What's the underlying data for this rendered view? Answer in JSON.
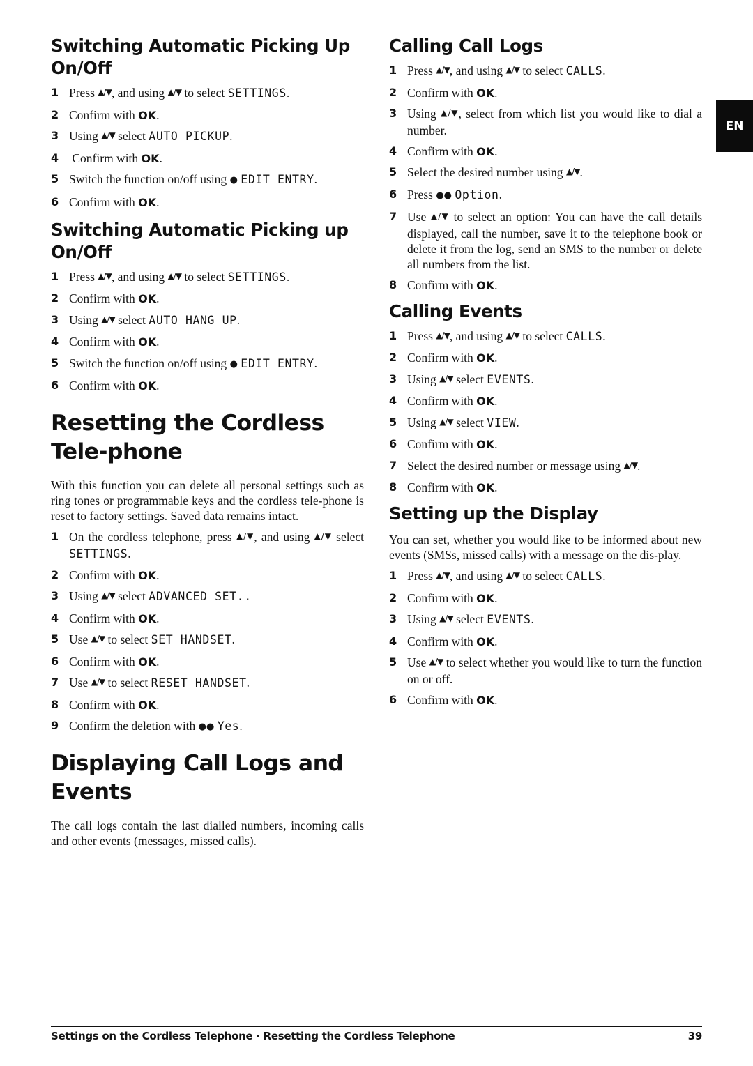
{
  "icons": {
    "up_down": "▲/▼",
    "single_dot": "●",
    "double_dot": "●●"
  },
  "language_tab": "EN",
  "left": {
    "section1": {
      "title": "Switching Automatic Picking Up On/Off",
      "steps": [
        {
          "n": "1",
          "pre": "Press ",
          "mid": ", and using ",
          "post": " to select ",
          "lcd": "SETTINGS",
          "end": "."
        },
        {
          "n": "2",
          "text": "Confirm with ",
          "ok": "OK",
          "end": "."
        },
        {
          "n": "3",
          "pre": "Using ",
          "post": " select ",
          "lcd": "AUTO PICKUP",
          "end": "."
        },
        {
          "n": "4",
          "text": " Confirm with ",
          "ok": "OK",
          "end": "."
        },
        {
          "n": "5",
          "text": "Switch the function on/off using ",
          "lcd": "EDIT ENTRY",
          "end": "."
        },
        {
          "n": "6",
          "text": "Confirm with ",
          "ok": "OK",
          "end": "."
        }
      ]
    },
    "section2": {
      "title": "Switching Automatic Picking up On/Off",
      "steps": [
        {
          "n": "1",
          "pre": "Press ",
          "mid": ", and using ",
          "post": " to select ",
          "lcd": "SETTINGS",
          "end": "."
        },
        {
          "n": "2",
          "text": "Confirm with ",
          "ok": "OK",
          "end": "."
        },
        {
          "n": "3",
          "pre": "Using ",
          "post": " select ",
          "lcd": "AUTO HANG UP",
          "end": "."
        },
        {
          "n": "4",
          "text": "Confirm with ",
          "ok": "OK",
          "end": "."
        },
        {
          "n": "5",
          "text": "Switch the function on/off using ",
          "lcd": "EDIT ENTRY",
          "end": "."
        },
        {
          "n": "6",
          "text": "Confirm with ",
          "ok": "OK",
          "end": "."
        }
      ]
    },
    "section3": {
      "title": "Resetting the Cordless Tele-phone",
      "intro": "With this function you can delete all personal settings such as ring tones or programmable keys and the cordless tele-phone is reset to factory settings. Saved data remains intact.",
      "steps": [
        {
          "n": "1",
          "pre": "On the cordless telephone, press ",
          "mid": ", and using ",
          "post": " select ",
          "lcd": "SETTINGS",
          "end": "."
        },
        {
          "n": "2",
          "text": "Confirm with ",
          "ok": "OK",
          "end": "."
        },
        {
          "n": "3",
          "pre": "Using ",
          "post": " select ",
          "lcd": "ADVANCED SET..",
          "end": ""
        },
        {
          "n": "4",
          "text": "Confirm with ",
          "ok": "OK",
          "end": "."
        },
        {
          "n": "5",
          "pre": "Use ",
          "post": " to select ",
          "lcd": "SET HANDSET",
          "end": "."
        },
        {
          "n": "6",
          "text": "Confirm with ",
          "ok": "OK",
          "end": "."
        },
        {
          "n": "7",
          "pre": "Use ",
          "post": " to select ",
          "lcd": "RESET HANDSET",
          "end": "."
        },
        {
          "n": "8",
          "text": "Confirm with ",
          "ok": "OK",
          "end": "."
        },
        {
          "n": "9",
          "text": "Confirm the deletion with ",
          "lcd": "Yes",
          "end": "."
        }
      ]
    },
    "section4": {
      "title": "Displaying Call Logs and Events",
      "intro": "The call logs contain the last dialled numbers, incoming calls and other events (messages, missed calls)."
    }
  },
  "right": {
    "section1": {
      "title": "Calling Call Logs",
      "steps": [
        {
          "n": "1",
          "pre": "Press ",
          "mid": ", and using ",
          "post": " to select ",
          "lcd": "CALLS",
          "end": "."
        },
        {
          "n": "2",
          "text": "Confirm with ",
          "ok": "OK",
          "end": "."
        },
        {
          "n": "3",
          "pre": "Using ",
          "post": ", select from which list you would like to dial a number."
        },
        {
          "n": "4",
          "text": "Confirm with ",
          "ok": "OK",
          "end": "."
        },
        {
          "n": "5",
          "pre": "Select the desired number using ",
          "end": "."
        },
        {
          "n": "6",
          "text": "Press ",
          "lcd": "Option",
          "end": "."
        },
        {
          "n": "7",
          "pre": "Use ",
          "post": " to select an option: You can have the call details displayed, call the number, save it to the telephone book or delete it from the log, send an SMS to the number or delete all numbers from the list."
        },
        {
          "n": "8",
          "text": "Confirm with ",
          "ok": "OK",
          "end": "."
        }
      ]
    },
    "section2": {
      "title": "Calling Events",
      "steps": [
        {
          "n": "1",
          "pre": "Press ",
          "mid": ", and using ",
          "post": " to select ",
          "lcd": "CALLS",
          "end": "."
        },
        {
          "n": "2",
          "text": "Confirm with ",
          "ok": "OK",
          "end": "."
        },
        {
          "n": "3",
          "pre": "Using ",
          "post": " select ",
          "lcd": "EVENTS",
          "end": "."
        },
        {
          "n": "4",
          "text": "Confirm with ",
          "ok": "OK",
          "end": "."
        },
        {
          "n": "5",
          "pre": "Using ",
          "post": " select ",
          "lcd": "VIEW",
          "end": "."
        },
        {
          "n": "6",
          "text": "Confirm with ",
          "ok": "OK",
          "end": "."
        },
        {
          "n": "7",
          "pre": "Select the desired number or message using ",
          "end": "."
        },
        {
          "n": "8",
          "text": "Confirm with ",
          "ok": "OK",
          "end": "."
        }
      ]
    },
    "section3": {
      "title": "Setting up the Display",
      "intro": "You can set, whether you would like to be informed about new events (SMSs, missed calls) with a message on the dis-play.",
      "steps": [
        {
          "n": "1",
          "pre": "Press ",
          "mid": ", and using ",
          "post": " to select ",
          "lcd": "CALLS",
          "end": "."
        },
        {
          "n": "2",
          "text": "Confirm with ",
          "ok": "OK",
          "end": "."
        },
        {
          "n": "3",
          "pre": "Using ",
          "post": " select ",
          "lcd": "EVENTS",
          "end": "."
        },
        {
          "n": "4",
          "text": "Confirm with ",
          "ok": "OK",
          "end": "."
        },
        {
          "n": "5",
          "pre": "Use ",
          "post": " to select whether you would like to turn the function on or off."
        },
        {
          "n": "6",
          "text": "Confirm with ",
          "ok": "OK",
          "end": "."
        }
      ]
    }
  },
  "footer": {
    "breadcrumb": "Settings on the Cordless Telephone · Resetting the Cordless Telephone",
    "page_number": "39"
  }
}
